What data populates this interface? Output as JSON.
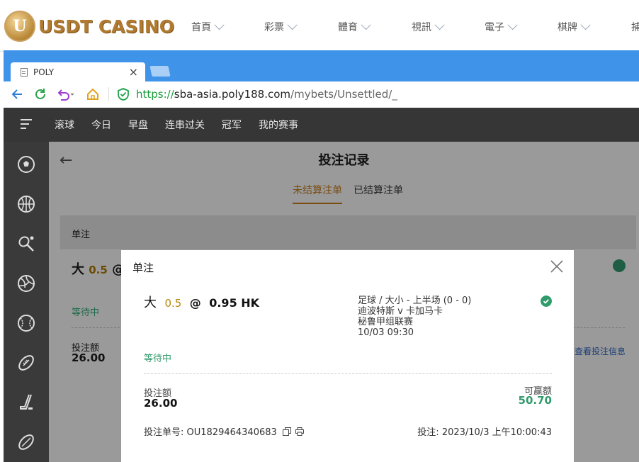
{
  "site": {
    "logo_text": "USDT CASINO",
    "nav": [
      "首頁",
      "彩票",
      "體育",
      "視訊",
      "電子",
      "棋牌",
      "捕"
    ]
  },
  "browser": {
    "tab_title": "POLY",
    "url_proto": "https://",
    "url_host": "sba-asia.poly188.com",
    "url_path": "/mybets/Unsettled/_"
  },
  "appnav": {
    "items": [
      "滚球",
      "今日",
      "早盘",
      "连串过关",
      "冠军",
      "我的赛事"
    ]
  },
  "sidebar": {
    "icons": [
      "soccer-icon",
      "basketball-icon",
      "tennis-icon",
      "volleyball-icon",
      "baseball-icon",
      "football-icon",
      "hockey-icon",
      "rugby-icon"
    ]
  },
  "page": {
    "title": "投注记录",
    "tabs": [
      "未结算注单",
      "已结算注单"
    ],
    "section": "单注"
  },
  "background_bet": {
    "selection": "大",
    "odds_line": "0.5",
    "at": "@",
    "status": "等待中",
    "stake_label": "投注额",
    "stake": "26.00",
    "view_link": "查看投注信息"
  },
  "modal": {
    "title": "单注",
    "selection": "大",
    "line": "0.5",
    "at": "@",
    "odds": "0.95 HK",
    "market": "足球 / 大小 - 上半场 (0 - 0)",
    "teams": "迪波特斯 v 卡加马卡",
    "league": "秘鲁甲组联赛",
    "match_time": "10/03 09:30",
    "status": "等待中",
    "stake_label": "投注额",
    "stake": "26.00",
    "win_label": "可赢额",
    "win": "50.70",
    "ref_label": "投注单号: ",
    "ref": "OU1829464340683",
    "time_label": "投注: ",
    "time": "2023/10/3 上午10:00:43"
  },
  "colors": {
    "browser_blue": "#3f94ea",
    "status_green": "#2f9a6a",
    "odds_gold": "#b8860b"
  }
}
